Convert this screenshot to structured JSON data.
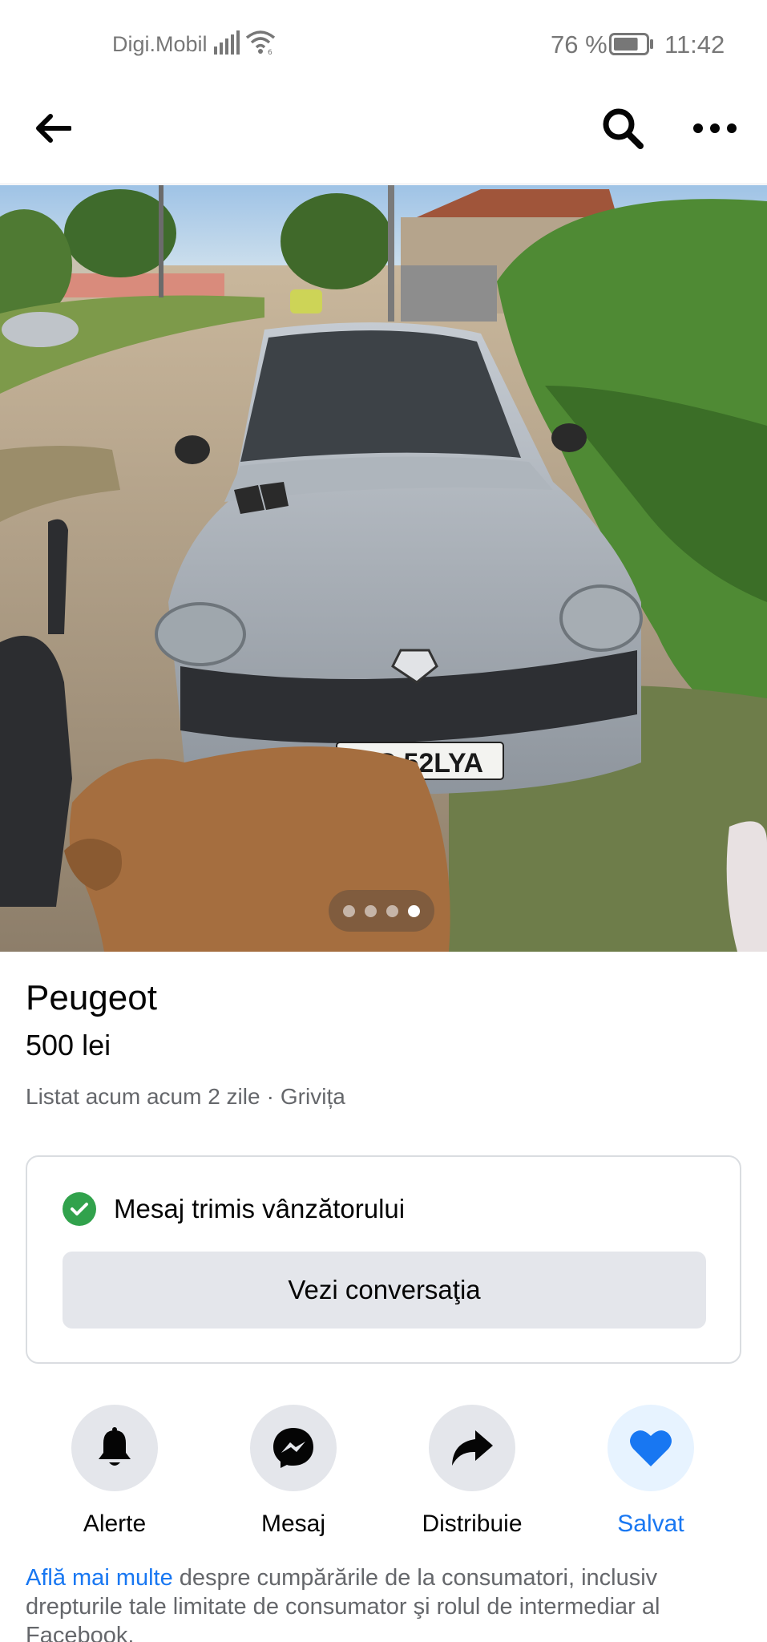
{
  "status_bar": {
    "carrier": "Digi.Mobil",
    "battery_percent": "76 %",
    "battery_level": 0.76,
    "time": "11:42",
    "icons": [
      "signal-icon",
      "wifi-icon",
      "battery-icon"
    ]
  },
  "nav": {
    "icons": [
      "back-arrow-icon",
      "search-icon",
      "more-icon"
    ]
  },
  "photo": {
    "plate": "BC 52LYA",
    "plate_country": "RO",
    "carousel_count": 4,
    "carousel_active_index": 3
  },
  "listing": {
    "title": "Peugeot",
    "price": "500 lei",
    "listed": "Listat acum acum 2 zile",
    "separator": "·",
    "location": "Grivița"
  },
  "message_card": {
    "status": "Mesaj trimis vânzătorului",
    "button": "Vezi conversaţia"
  },
  "actions": [
    {
      "label": "Alerte",
      "icon": "bell-icon"
    },
    {
      "label": "Mesaj",
      "icon": "messenger-icon"
    },
    {
      "label": "Distribuie",
      "icon": "share-icon"
    },
    {
      "label": "Salvat",
      "icon": "heart-icon"
    }
  ],
  "footer": {
    "link": "Află mai multe",
    "text": " despre cumpărările de la consumatori, inclusiv drepturile tale limitate de consumator şi rolul de intermediar al Facebook."
  },
  "colors": {
    "accent": "#1877f2",
    "success": "#31a24c",
    "button_bg": "#e4e6eb",
    "secondary_text": "#65676b"
  }
}
